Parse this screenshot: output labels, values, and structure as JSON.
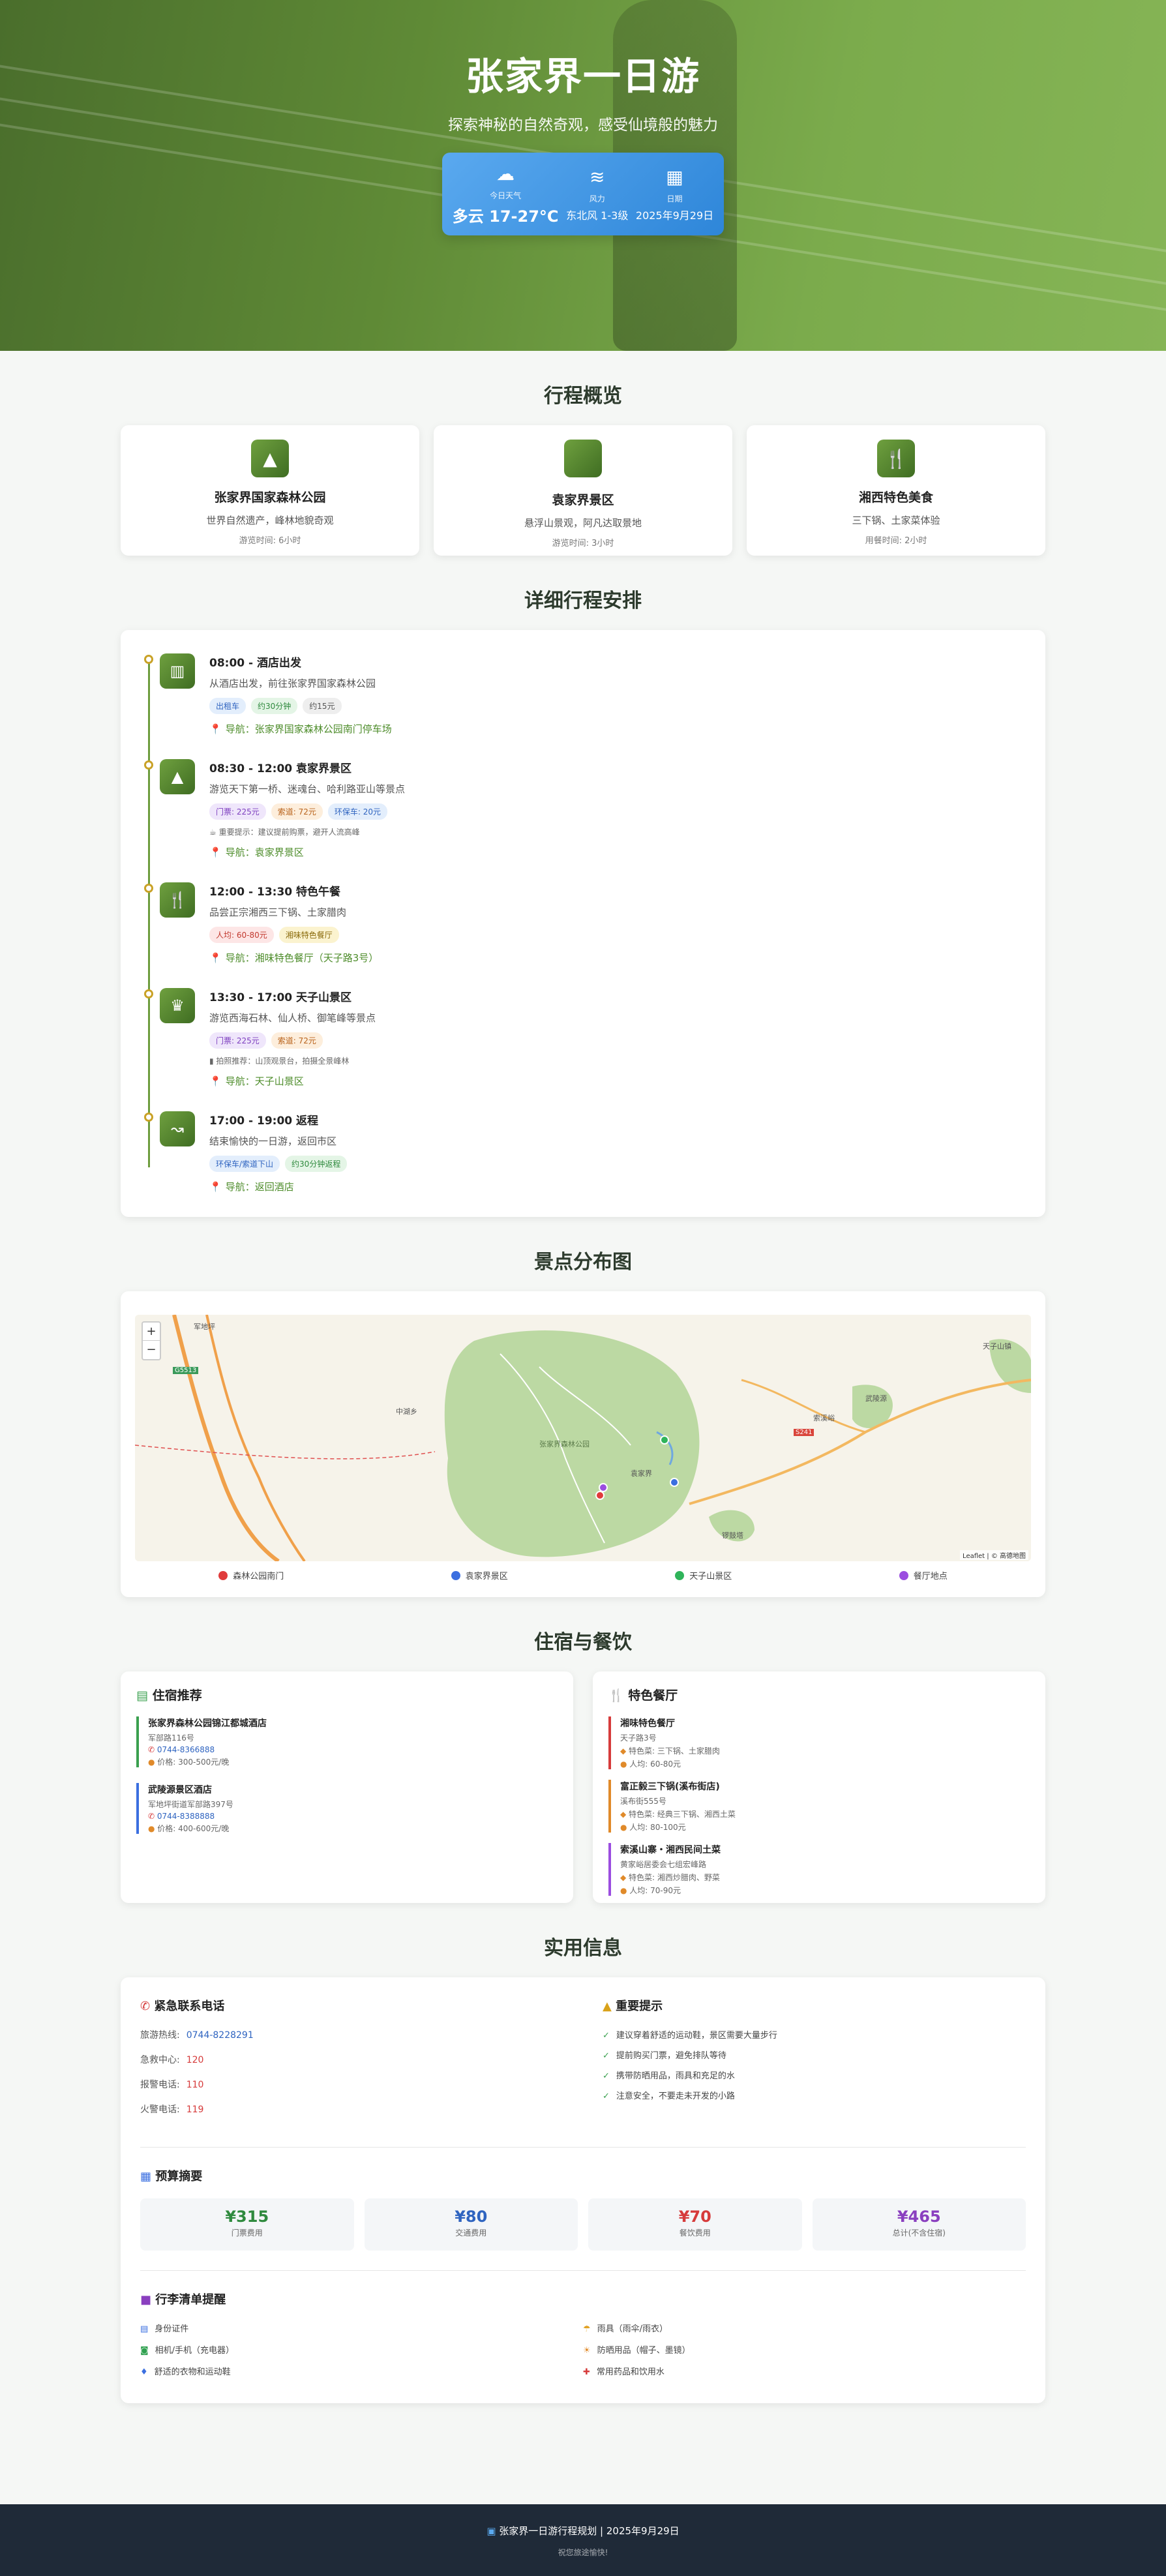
{
  "hero": {
    "title": "张家界一日游",
    "subtitle": "探索神秘的自然奇观，感受仙境般的魅力",
    "weather": [
      {
        "label": "今日天气",
        "value": "多云 17-27°C",
        "icon": "cloud-icon"
      },
      {
        "label": "风力",
        "value": "东北风 1-3级",
        "icon": "wind-icon"
      },
      {
        "label": "日期",
        "value": "2025年9月29日",
        "icon": "calendar-icon"
      }
    ]
  },
  "overview": {
    "title": "行程概览",
    "cards": [
      {
        "name": "张家界国家森林公园",
        "desc": "世界自然遗产，峰林地貌奇观",
        "time": "游览时间: 6小时",
        "icon": "mountain-icon"
      },
      {
        "name": "袁家界景区",
        "desc": "悬浮山景观，阿凡达取景地",
        "time": "游览时间: 3小时",
        "icon": "square-icon"
      },
      {
        "name": "湘西特色美食",
        "desc": "三下锅、土家菜体验",
        "time": "用餐时间: 2小时",
        "icon": "utensils-icon"
      }
    ]
  },
  "schedule": {
    "title": "详细行程安排",
    "steps": [
      {
        "time": "08:00 - 酒店出发",
        "desc": "从酒店出发，前往张家界国家森林公园",
        "tags": [
          "出租车",
          "约30分钟",
          "约15元"
        ],
        "tip": "",
        "nav": "导航：张家界国家森林公园南门停车场",
        "icon": "building-icon"
      },
      {
        "time": "08:30 - 12:00 袁家界景区",
        "desc": "游览天下第一桥、迷魂台、哈利路亚山等景点",
        "tags": [
          "门票: 225元",
          "索道: 72元",
          "环保车: 20元"
        ],
        "tip": "☕ 重要提示：建议提前购票，避开人流高峰",
        "nav": "导航：袁家界景区",
        "icon": "mountain-icon"
      },
      {
        "time": "12:00 - 13:30 特色午餐",
        "desc": "品尝正宗湘西三下锅、土家腊肉",
        "tags": [
          "人均: 60-80元",
          "湘味特色餐厅"
        ],
        "tip": "",
        "nav": "导航：湘味特色餐厅（天子路3号）",
        "icon": "utensils-icon"
      },
      {
        "time": "13:30 - 17:00 天子山景区",
        "desc": "游览西海石林、仙人桥、御笔峰等景点",
        "tags": [
          "门票: 225元",
          "索道: 72元"
        ],
        "tip": "▮ 拍照推荐：山顶观景台，拍摄全景峰林",
        "nav": "导航：天子山景区",
        "icon": "crown-icon"
      },
      {
        "time": "17:00 - 19:00 返程",
        "desc": "结束愉快的一日游，返回市区",
        "tags": [
          "环保车/索道下山",
          "约30分钟返程"
        ],
        "tip": "",
        "nav": "导航：返回酒店",
        "icon": "route-icon"
      }
    ]
  },
  "map": {
    "title": "景点分布图",
    "zoom_in": "+",
    "zoom_out": "−",
    "attribution": "Leaflet | © 高德地图",
    "place_labels": [
      "张家界森林公园",
      "天子山镇",
      "袁家界",
      "武陵源",
      "锣鼓塔",
      "索溪峪",
      "军地坪",
      "中湖乡",
      "S241",
      "G5513"
    ],
    "legend": [
      {
        "label": "森林公园南门",
        "color": "#e03b3b"
      },
      {
        "label": "袁家界景区",
        "color": "#3b6fe0"
      },
      {
        "label": "天子山景区",
        "color": "#2fb45a"
      },
      {
        "label": "餐厅地点",
        "color": "#9b4de0"
      }
    ]
  },
  "stay": {
    "title": "住宿与餐饮",
    "hotel_title": "住宿推荐",
    "hotels": [
      {
        "name": "张家界森林公园锦江都城酒店",
        "addr": "军部路116号",
        "phone": "0744-8366888",
        "price": "价格: 300-500元/晚",
        "color": "#3aa04f"
      },
      {
        "name": "武陵源景区酒店",
        "addr": "军地坪街道军部路397号",
        "phone": "0744-8388888",
        "price": "价格: 400-600元/晚",
        "color": "#3b6fe0"
      }
    ],
    "food_title": "特色餐厅",
    "restaurants": [
      {
        "name": "湘味特色餐厅",
        "addr": "天子路3号",
        "dish": "特色菜: 三下锅、土家腊肉",
        "price": "人均: 60-80元",
        "color": "#d63b3b"
      },
      {
        "name": "富正毅三下锅(溪布街店)",
        "addr": "溪布街555号",
        "dish": "特色菜: 经典三下锅、湘西土菜",
        "price": "人均: 80-100元",
        "color": "#e08a2a"
      },
      {
        "name": "索溪山寨・湘西民间土菜",
        "addr": "黄家峪居委会七组宏峰路",
        "dish": "特色菜: 湘西炒腊肉、野菜",
        "price": "人均: 70-90元",
        "color": "#9b4de0"
      }
    ]
  },
  "info": {
    "title": "实用信息",
    "contacts_title": "紧急联系电话",
    "contacts": [
      {
        "label": "旅游热线:",
        "value": "0744-8228291",
        "color": "#2f64c0"
      },
      {
        "label": "急救中心:",
        "value": "120",
        "color": "#d63b3b"
      },
      {
        "label": "报警电话:",
        "value": "110",
        "color": "#d63b3b"
      },
      {
        "label": "火警电话:",
        "value": "119",
        "color": "#d63b3b"
      }
    ],
    "tips_title": "重要提示",
    "tips": [
      "建议穿着舒适的运动鞋，景区需要大量步行",
      "提前购买门票，避免排队等待",
      "携带防晒用品，雨具和充足的水",
      "注意安全，不要走未开发的小路"
    ],
    "budget_title": "预算摘要",
    "budget": [
      {
        "value": "¥315",
        "label": "门票费用",
        "color": "#2f8a3e"
      },
      {
        "value": "¥80",
        "label": "交通费用",
        "color": "#2f64c0"
      },
      {
        "value": "¥70",
        "label": "餐饮费用",
        "color": "#d63b3b"
      },
      {
        "value": "¥465",
        "label": "总计(不含住宿)",
        "color": "#8a3fbf"
      }
    ],
    "pack_title": "行李清单提醒",
    "pack": [
      {
        "label": "身份证件",
        "icon": "▤",
        "color": "#3b6fe0"
      },
      {
        "label": "雨具（雨伞/雨衣）",
        "icon": "☂",
        "color": "#e0a020"
      },
      {
        "label": "相机/手机（充电器）",
        "icon": "◙",
        "color": "#2fa04f"
      },
      {
        "label": "防晒用品（帽子、墨镜）",
        "icon": "☀",
        "color": "#e08a2a"
      },
      {
        "label": "舒适的衣物和运动鞋",
        "icon": "👕",
        "color": "#3b6fe0"
      },
      {
        "label": "常用药品和饮用水",
        "icon": "✚",
        "color": "#d63b3b"
      }
    ]
  },
  "footer": {
    "line1": "张家界一日游行程规划 | 2025年9月29日",
    "line2": "祝您旅途愉快!"
  }
}
